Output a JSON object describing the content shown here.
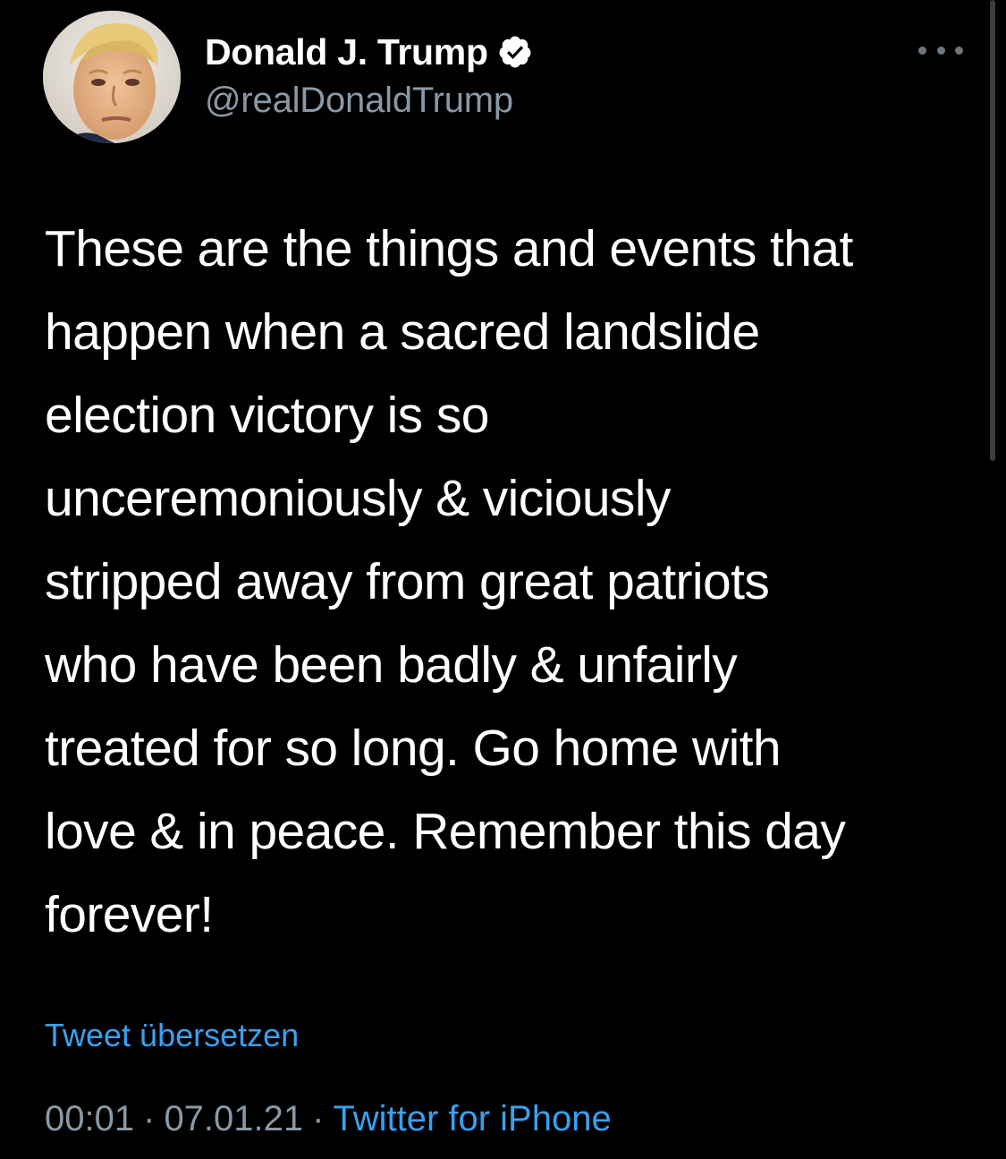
{
  "author": {
    "display_name": "Donald J. Trump",
    "handle": "@realDonaldTrump",
    "verified": true
  },
  "tweet": {
    "text": "These are the things and events that\nhappen when a sacred landslide\nelection victory is so\nunceremoniously & viciously\nstripped away from great patriots\nwho have been badly & unfairly\ntreated for so long. Go home with\nlove & in peace. Remember this day\nforever!",
    "translate_label": "Tweet übersetzen",
    "time": "00:01",
    "date": "07.01.21",
    "separator": "·",
    "source": "Twitter for iPhone"
  },
  "icons": {
    "verified": "verified-badge-icon",
    "more": "more-options-icon"
  },
  "colors": {
    "background": "#000000",
    "text": "#ffffff",
    "secondary": "#8b98a5",
    "link": "#3aa0ef"
  }
}
